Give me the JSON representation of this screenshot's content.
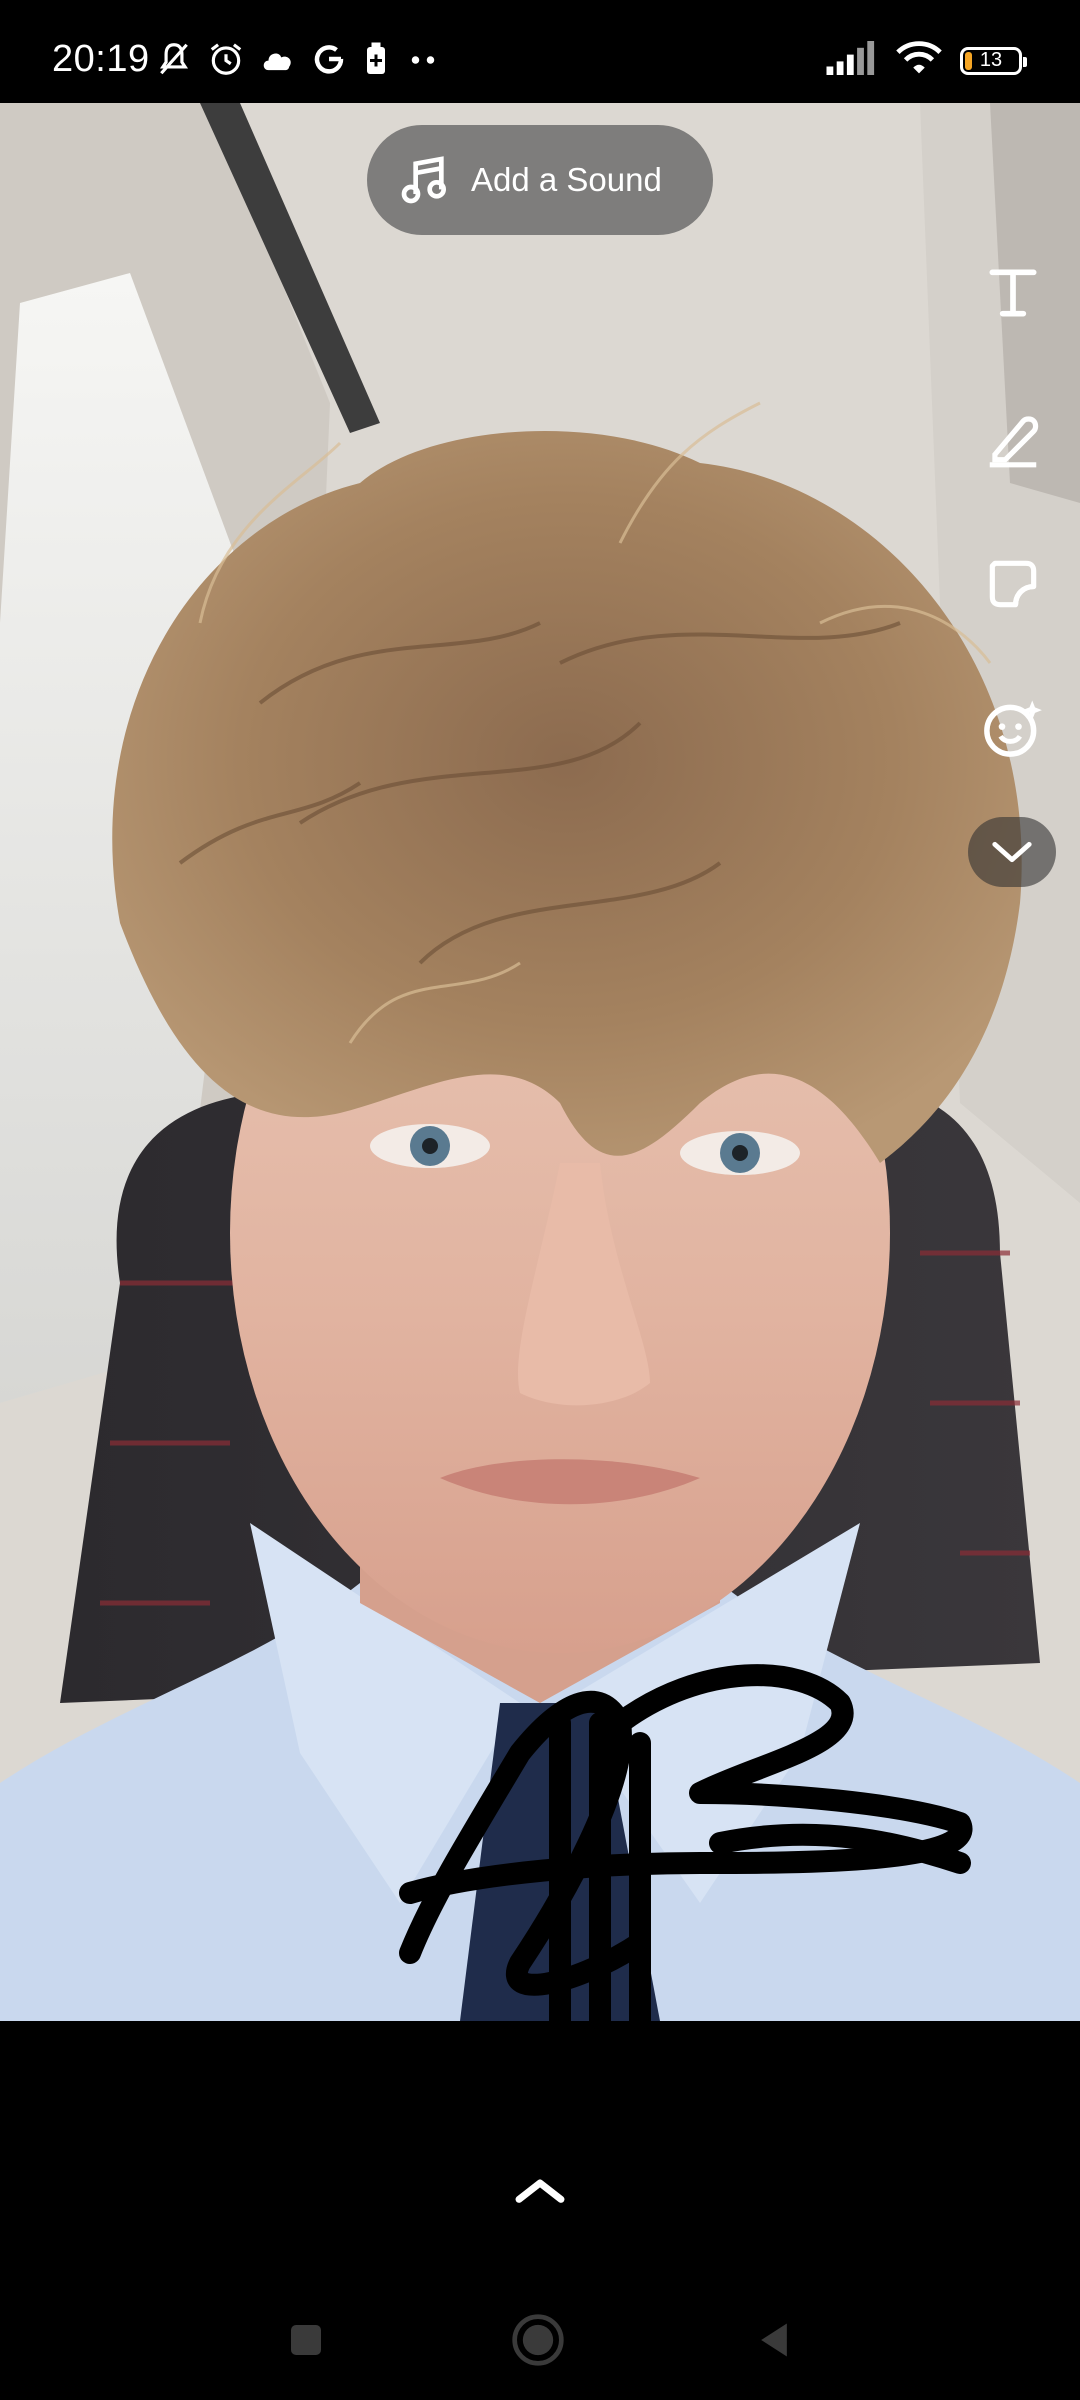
{
  "status_bar": {
    "time": "20:19",
    "battery_level": "13",
    "left_icons": [
      "mute-bell-icon",
      "alarm-icon",
      "cloud-icon",
      "google-icon",
      "battery-saver-icon",
      "more-dots-icon"
    ],
    "right_icons": [
      "signal-icon",
      "wifi-icon",
      "battery-icon"
    ]
  },
  "top_bar": {
    "sound_label": "Add a Sound"
  },
  "tools": [
    "text-tool-icon",
    "pen-tool-icon",
    "sticker-tool-icon",
    "emoji-lens-icon",
    "chevron-down-icon"
  ],
  "bottom": {
    "expand_icon": "chevron-up-icon"
  },
  "navigation": [
    "recents-button",
    "home-button",
    "back-button"
  ],
  "colors": {
    "battery_low": "#f5a524",
    "pill_bg": "#5a5a5a"
  }
}
